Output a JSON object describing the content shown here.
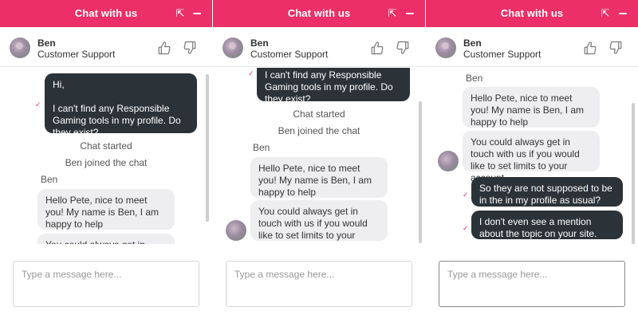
{
  "window": {
    "title": "Chat with us",
    "expand_symbol": "⇱",
    "accent_color": "#ec2f66"
  },
  "agent": {
    "name": "Ben",
    "role": "Customer Support"
  },
  "composer": {
    "placeholder": "Type a message here..."
  },
  "conversation": {
    "user_question": "Hi,\n\nI can't find any Responsible Gaming tools in my profile. Do they exist?",
    "user_question_tail": "I can't find any Responsible Gaming tools in my profile. Do they exist?",
    "chat_started": "Chat started",
    "agent_joined": "Ben joined the chat",
    "sender": "Ben",
    "agent_greeting": "Hello Pete, nice to meet you! My name is Ben, I am happy to help",
    "agent_limits": "You could always get in touch with us if you would like to set limits to your account",
    "agent_limits_partial": "You could always get in touch",
    "user_followup_1": "So they are not supposed to be in the in my profile as usual?",
    "user_followup_2": "I don't even see a mention about the topic on your site.",
    "tick": "✓"
  }
}
